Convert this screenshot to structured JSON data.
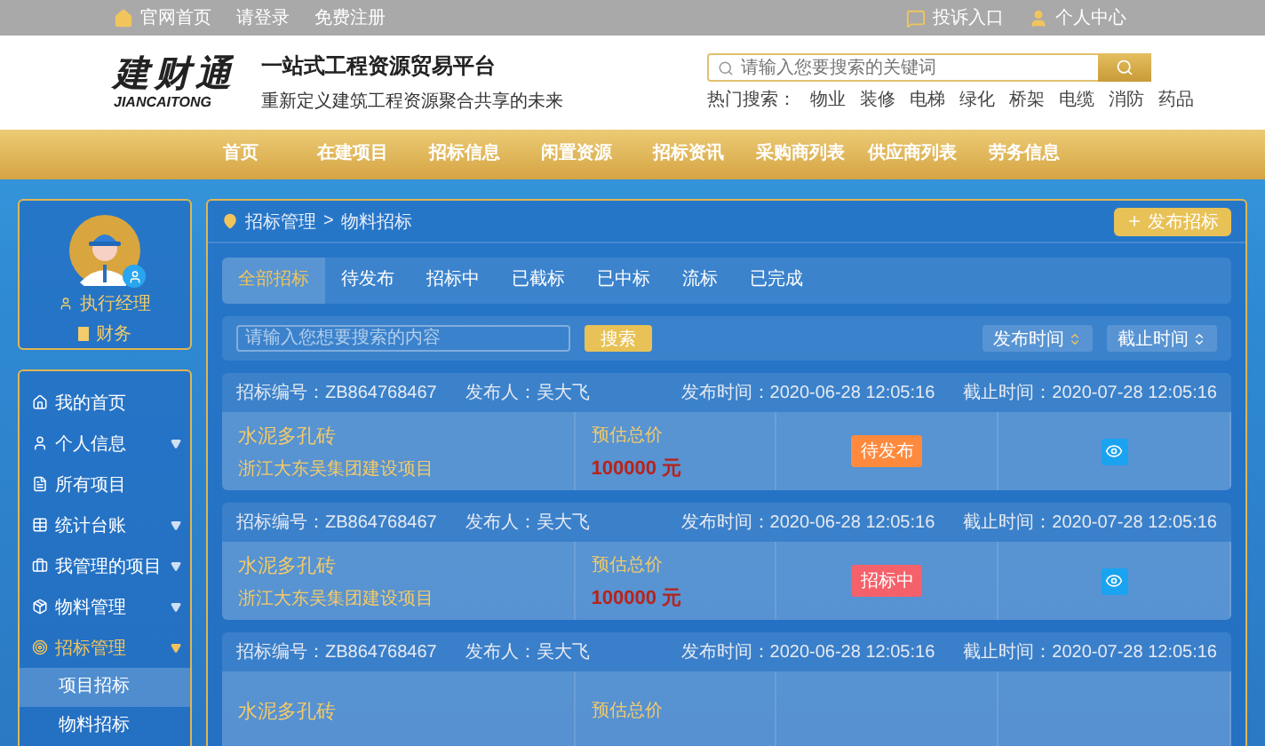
{
  "top_bar": {
    "left_links": [
      {
        "label": "官网首页",
        "kind": "home"
      },
      {
        "label": "请登录",
        "kind": "text"
      },
      {
        "label": "免费注册",
        "kind": "text"
      }
    ],
    "right_links": [
      {
        "label": "投诉入口",
        "kind": "complaint"
      },
      {
        "label": "个人中心",
        "kind": "user"
      }
    ]
  },
  "header": {
    "logo": {
      "name": "建财通",
      "sub": "JIANCAITONG"
    },
    "slogan": "一站式工程资源贸易平台",
    "tagline": "重新定义建筑工程资源聚合共享的未来",
    "search": {
      "placeholder": "请输入您要搜索的关键词"
    },
    "hot_label": "热门搜索：",
    "hot_words": [
      "物业",
      "装修",
      "电梯",
      "绿化",
      "桥架",
      "电缆",
      "消防",
      "药品"
    ]
  },
  "nav": [
    "首页",
    "在建项目",
    "招标信息",
    "闲置资源",
    "招标资讯",
    "采购商列表",
    "供应商列表",
    "劳务信息"
  ],
  "profile": {
    "roles": [
      {
        "label": "执行经理",
        "kind": "manager"
      },
      {
        "label": "财务",
        "kind": "finance"
      }
    ]
  },
  "menu": [
    {
      "label": "我的首页",
      "has_submenu": false,
      "expanded": false
    },
    {
      "label": "个人信息",
      "has_submenu": true,
      "expanded": false
    },
    {
      "label": "所有项目",
      "has_submenu": false,
      "expanded": false
    },
    {
      "label": "统计台账",
      "has_submenu": true,
      "expanded": false
    },
    {
      "label": "我管理的项目",
      "has_submenu": true,
      "expanded": false
    },
    {
      "label": "物料管理",
      "has_submenu": true,
      "expanded": false
    },
    {
      "label": "招标管理",
      "has_submenu": true,
      "expanded": true,
      "children": [
        {
          "label": "项目招标",
          "selected": true
        },
        {
          "label": "物料招标",
          "selected": false
        }
      ]
    }
  ],
  "main": {
    "breadcrumb": [
      "招标管理",
      "物料招标"
    ],
    "breadcrumb_separator": ">",
    "publish_button": "发布招标",
    "tabs": [
      {
        "label": "全部招标",
        "selected": true
      },
      {
        "label": "待发布",
        "selected": false
      },
      {
        "label": "招标中",
        "selected": false
      },
      {
        "label": "已截标",
        "selected": false
      },
      {
        "label": "已中标",
        "selected": false
      },
      {
        "label": "流标",
        "selected": false
      },
      {
        "label": "已完成",
        "selected": false
      }
    ],
    "search": {
      "placeholder": "请输入您想要搜索的内容",
      "button": "搜索"
    },
    "sorts": [
      "发布时间",
      "截止时间"
    ],
    "rows": [
      {
        "code": "招标编号：ZB864768467",
        "publisher": "发布人：吴大飞",
        "publish_time": "发布时间：2020-06-28 12:05:16",
        "deadline": "截止时间：2020-07-28 12:05:16",
        "title": "水泥多孔砖",
        "project": "浙江大东吴集团建设项目",
        "price_label": "预估总价",
        "price": "100000 元",
        "status": {
          "label": "待发布",
          "color": "#ff8a3d"
        }
      },
      {
        "code": "招标编号：ZB864768467",
        "publisher": "发布人：吴大飞",
        "publish_time": "发布时间：2020-06-28 12:05:16",
        "deadline": "截止时间：2020-07-28 12:05:16",
        "title": "水泥多孔砖",
        "project": "浙江大东吴集团建设项目",
        "price_label": "预估总价",
        "price": "100000 元",
        "status": {
          "label": "招标中",
          "color": "#f5616a"
        }
      },
      {
        "code": "招标编号：ZB864768467",
        "publisher": "发布人：吴大飞",
        "publish_time": "发布时间：2020-06-28 12:05:16",
        "deadline": "截止时间：2020-07-28 12:05:16",
        "title": "水泥多孔砖",
        "price_label": "预估总价"
      }
    ]
  }
}
